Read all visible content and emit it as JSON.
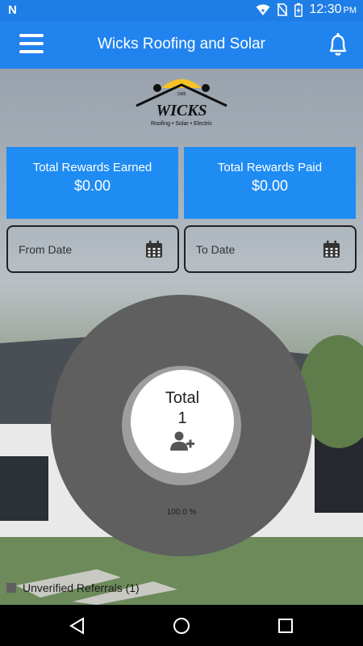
{
  "status_bar": {
    "carrier_mark": "N",
    "time": "12:30",
    "ampm": "PM",
    "icons": [
      "wifi-icon",
      "no-sim-icon",
      "battery-charging-icon"
    ]
  },
  "app_bar": {
    "title": "Wicks Roofing and Solar",
    "menu_icon": "hamburger-menu-icon",
    "bell_icon": "bell-icon"
  },
  "logo": {
    "brand": "WICKS",
    "since": "1985",
    "tagline": "Roofing • Solar • Electric"
  },
  "cards": {
    "earned": {
      "label": "Total Rewards Earned",
      "value": "$0.00"
    },
    "paid": {
      "label": "Total Rewards Paid",
      "value": "$0.00"
    }
  },
  "dates": {
    "from": "From Date",
    "to": "To Date"
  },
  "chart_data": {
    "type": "pie",
    "categories": [
      "Unverified Referrals"
    ],
    "values": [
      1
    ],
    "percent_labels": [
      "100.0 %"
    ],
    "center_label": "Total",
    "center_value": "1",
    "legend": [
      "Unverified Referrals (1)"
    ],
    "colors": [
      "#5f5f5f"
    ]
  },
  "colors": {
    "primary": "#2183ee",
    "card": "#1f8cf3",
    "donut": "#5f5f5f",
    "donut_ring": "#9e9e9e"
  }
}
